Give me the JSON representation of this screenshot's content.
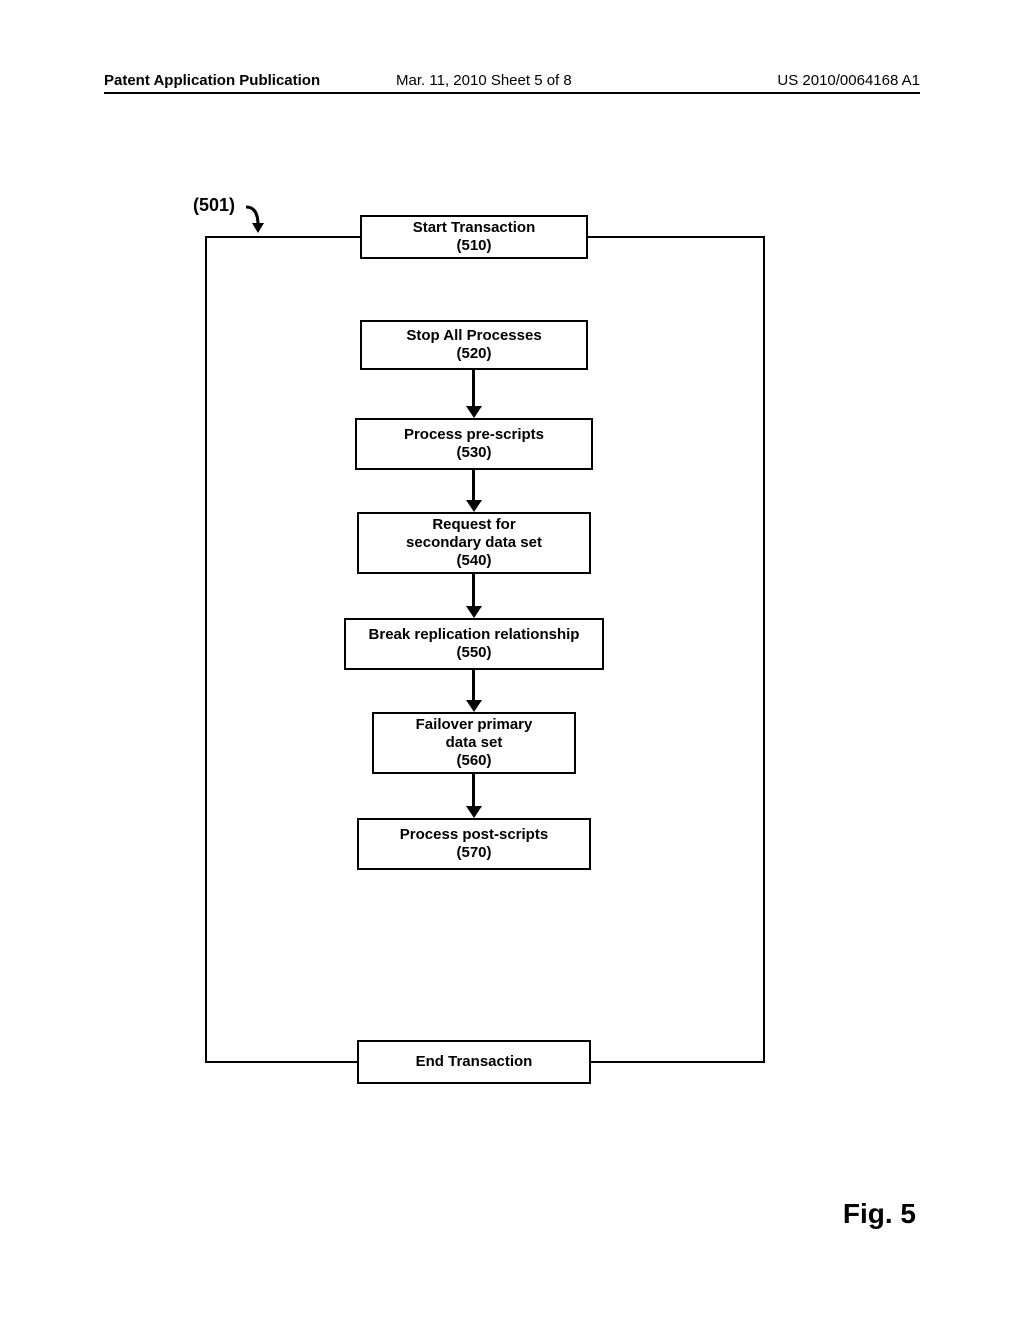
{
  "header": {
    "left": "Patent Application Publication",
    "mid": "Mar. 11, 2010  Sheet 5 of 8",
    "right": "US 2010/0064168 A1"
  },
  "ref": {
    "label": "(501)"
  },
  "boxes": {
    "start": {
      "l1": "Start Transaction",
      "l2": "(510)"
    },
    "stop": {
      "l1": "Stop All Processes",
      "l2": "(520)"
    },
    "pre": {
      "l1": "Process pre-scripts",
      "l2": "(530)"
    },
    "req": {
      "l1": "Request for",
      "l2": "secondary data set",
      "l3": "(540)"
    },
    "break": {
      "l1": "Break replication relationship",
      "l2": "(550)"
    },
    "fail": {
      "l1": "Failover primary",
      "l2": "data set",
      "l3": "(560)"
    },
    "post": {
      "l1": "Process post-scripts",
      "l2": "(570)"
    },
    "end": {
      "l1": "End Transaction"
    }
  },
  "figure": {
    "label": "Fig. 5"
  }
}
